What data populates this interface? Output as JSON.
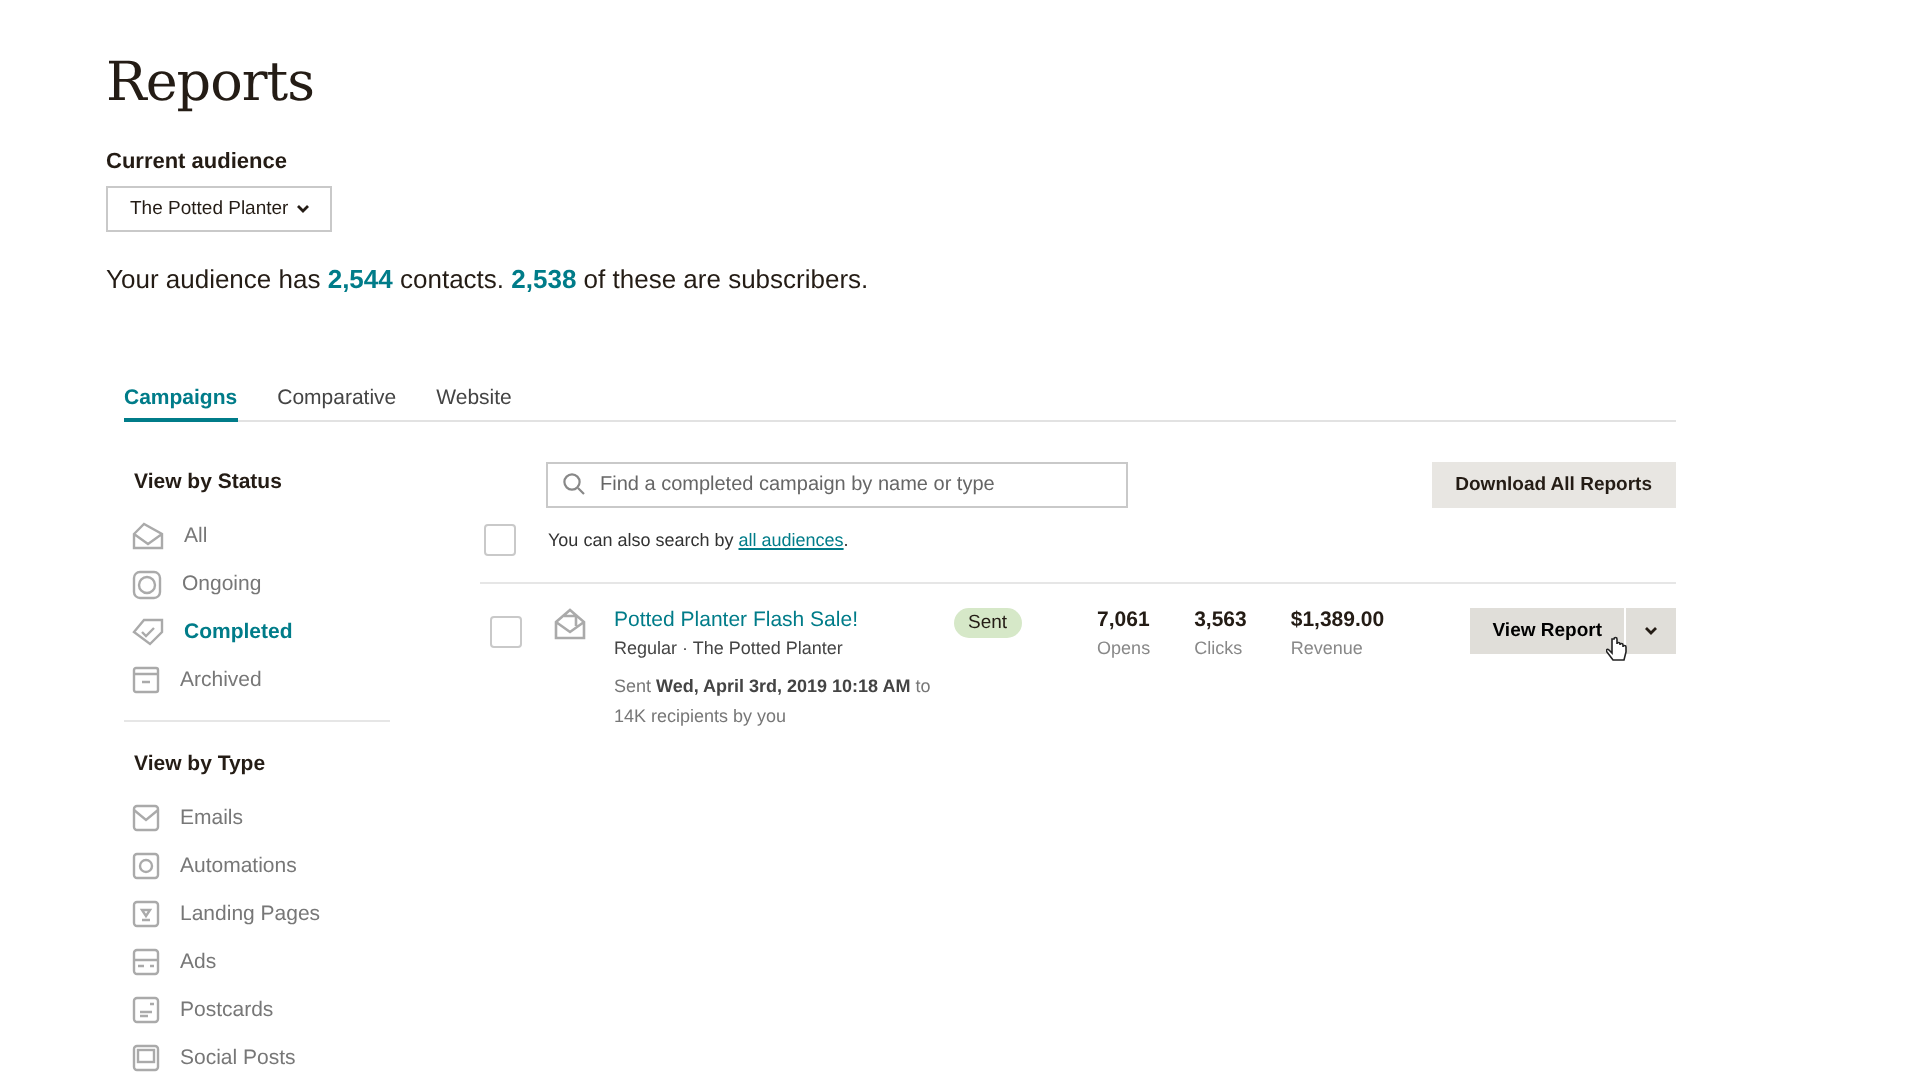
{
  "title": "Reports",
  "audience": {
    "label": "Current audience",
    "value": "The Potted Planter",
    "summary": "Your audience has **2,544** contacts. **2,538** of these are subscribers."
  },
  "tabs": [
    {
      "label": "Campaigns",
      "selected": true
    },
    {
      "label": "Comparative",
      "selected": false
    },
    {
      "label": "Website",
      "selected": false
    }
  ],
  "status_heading": "View by Status",
  "status_items": [
    {
      "label": "All",
      "selected": false
    },
    {
      "label": "Ongoing",
      "selected": false
    },
    {
      "label": "Completed",
      "selected": true
    },
    {
      "label": "Archived",
      "selected": false
    }
  ],
  "type_heading": "View by Type",
  "type_items": [
    {
      "label": "Emails"
    },
    {
      "label": "Automations"
    },
    {
      "label": "Landing Pages"
    },
    {
      "label": "Ads"
    },
    {
      "label": "Postcards"
    },
    {
      "label": "Social Posts"
    }
  ],
  "search": {
    "placeholder": "Find a completed campaign by name or type"
  },
  "download_button": "Download All Reports",
  "hint": {
    "before": "You can also search by",
    "link": "all audiences",
    "after": "."
  },
  "select_all": {
    "checked": false
  },
  "campaigns": [
    {
      "checked": false,
      "name": "Potted Planter Flash Sale!",
      "subtitle": "Regular · The Potted Planter",
      "sent_line": "Sent **Wed, April 3rd, 2019 10:18 AM** to 14K recipients by you",
      "status": "Sent",
      "stats": [
        {
          "value": "7,061",
          "label": "Opens"
        },
        {
          "value": "3,563",
          "label": "Clicks"
        },
        {
          "value": "$1,389.00",
          "label": "Revenue"
        }
      ],
      "action": "View Report"
    }
  ]
}
